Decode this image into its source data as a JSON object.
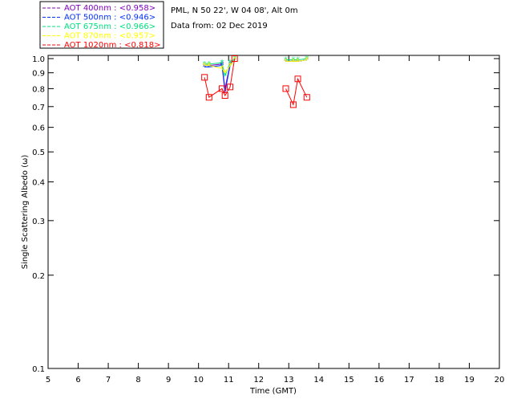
{
  "header": {
    "site": "PML, N 50 22', W 04 08', Alt 0m",
    "date": "Data from: 02 Dec 2019"
  },
  "chart_data": {
    "type": "line",
    "xlabel": "Time (GMT)",
    "ylabel": "Single Scattering Albedo (ω)",
    "xlim": [
      5,
      20
    ],
    "ylim": [
      0.1,
      1.0
    ],
    "yscale": "log",
    "xticks": [
      "5",
      "6",
      "7",
      "8",
      "9",
      "10",
      "11",
      "12",
      "13",
      "14",
      "15",
      "16",
      "17",
      "18",
      "19",
      "20"
    ],
    "yticks": [
      "0.1",
      "0.2",
      "0.3",
      "0.4",
      "0.5",
      "0.6",
      "0.7",
      "0.8",
      "0.9",
      "1.0"
    ],
    "legend_position": "top-left",
    "x": [
      10.2,
      10.35,
      10.78,
      10.88,
      11.05,
      11.2,
      12.9,
      13.15,
      13.3,
      13.6
    ],
    "series": [
      {
        "name": "AOT  400nm : <0.958>",
        "color": "#7f00c0",
        "values": [
          0.95,
          0.95,
          0.96,
          0.8,
          0.96,
          0.99,
          0.98,
          0.98,
          0.98,
          0.99
        ]
      },
      {
        "name": "AOT  500nm : <0.946>",
        "color": "#0030ff",
        "values": [
          0.94,
          0.94,
          0.95,
          0.78,
          0.95,
          0.99,
          0.98,
          0.98,
          0.98,
          0.99
        ]
      },
      {
        "name": "AOT  675nm : <0.966>",
        "color": "#00e080",
        "values": [
          0.96,
          0.96,
          0.97,
          0.88,
          0.97,
          1.0,
          0.99,
          0.99,
          0.99,
          1.0
        ]
      },
      {
        "name": "AOT  870nm : <0.957>",
        "color": "#ffff00",
        "values": [
          0.95,
          0.95,
          0.93,
          0.9,
          0.95,
          0.99,
          0.98,
          0.98,
          0.98,
          0.99
        ]
      },
      {
        "name": "AOT 1020nm : <0.818>",
        "color": "#ff0000",
        "values": [
          0.87,
          0.75,
          0.8,
          0.76,
          0.81,
          1.0,
          0.8,
          0.71,
          0.86,
          0.75
        ]
      }
    ]
  }
}
